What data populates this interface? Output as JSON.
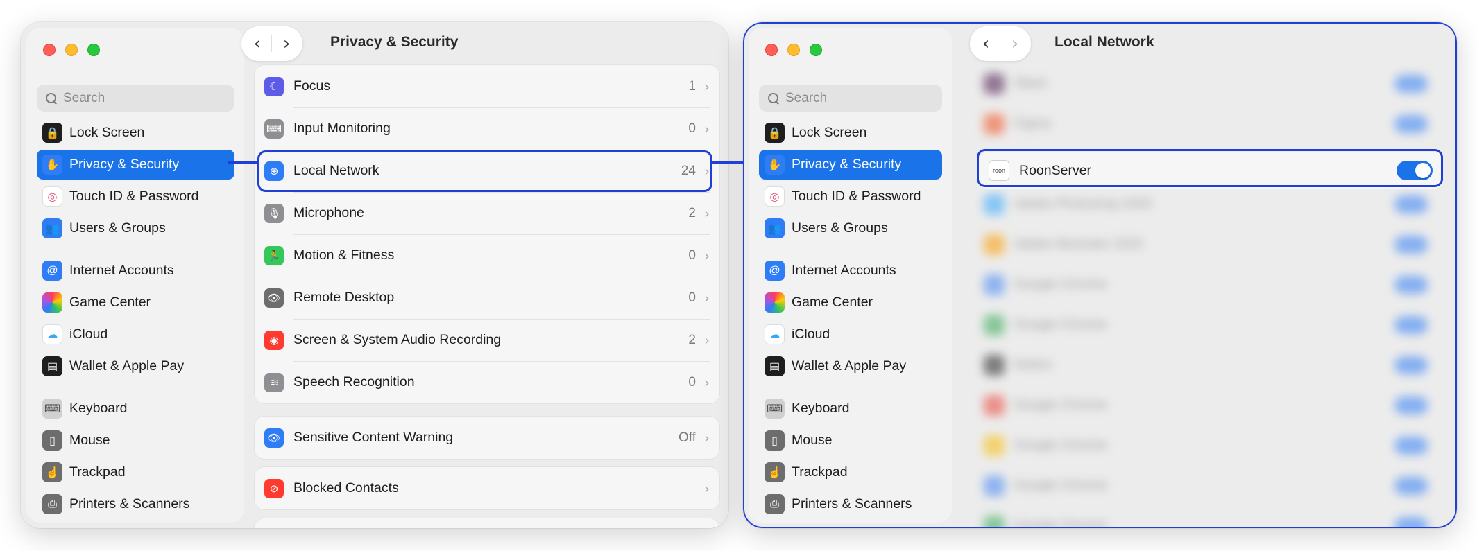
{
  "left_window": {
    "title": "Privacy & Security",
    "search_placeholder": "Search",
    "sidebar": [
      {
        "label": "Lock Screen",
        "icon": "lock-icon",
        "glyph": "🔒"
      },
      {
        "label": "Privacy & Security",
        "icon": "hand-icon",
        "glyph": "✋",
        "selected": true
      },
      {
        "label": "Touch ID & Password",
        "icon": "fingerprint-icon",
        "glyph": "◎"
      },
      {
        "label": "Users & Groups",
        "icon": "users-icon",
        "glyph": "👥"
      },
      {
        "label": "Internet Accounts",
        "icon": "at-icon",
        "glyph": "@"
      },
      {
        "label": "Game Center",
        "icon": "game-center-icon",
        "glyph": ""
      },
      {
        "label": "iCloud",
        "icon": "cloud-icon",
        "glyph": "☁"
      },
      {
        "label": "Wallet & Apple Pay",
        "icon": "wallet-icon",
        "glyph": "▤"
      },
      {
        "label": "Keyboard",
        "icon": "keyboard-icon",
        "glyph": "⌨"
      },
      {
        "label": "Mouse",
        "icon": "mouse-icon",
        "glyph": "▯"
      },
      {
        "label": "Trackpad",
        "icon": "trackpad-icon",
        "glyph": "☝"
      },
      {
        "label": "Printers & Scanners",
        "icon": "printer-icon",
        "glyph": "⎙"
      }
    ],
    "privacy_rows": [
      {
        "label": "Focus",
        "count": "1",
        "icon": "moon-icon",
        "glyph": "☾"
      },
      {
        "label": "Input Monitoring",
        "count": "0",
        "icon": "keyboard-icon",
        "glyph": "⌨"
      },
      {
        "label": "Local Network",
        "count": "24",
        "icon": "globe-icon",
        "glyph": "⊕"
      },
      {
        "label": "Microphone",
        "count": "2",
        "icon": "microphone-icon",
        "glyph": "🎙"
      },
      {
        "label": "Motion & Fitness",
        "count": "0",
        "icon": "running-icon",
        "glyph": "🏃"
      },
      {
        "label": "Remote Desktop",
        "count": "0",
        "icon": "binoculars-icon",
        "glyph": "👁"
      },
      {
        "label": "Screen & System Audio Recording",
        "count": "2",
        "icon": "record-icon",
        "glyph": "◉"
      },
      {
        "label": "Speech Recognition",
        "count": "0",
        "icon": "waveform-icon",
        "glyph": "≋"
      }
    ],
    "sensitive_row": {
      "label": "Sensitive Content Warning",
      "value": "Off",
      "icon": "eye-icon",
      "glyph": "👁"
    },
    "blocked_row": {
      "label": "Blocked Contacts",
      "icon": "blocked-icon",
      "glyph": "⊘"
    }
  },
  "right_window": {
    "title": "Local Network",
    "search_placeholder": "Search",
    "highlighted_app": {
      "label": "RoonServer",
      "logo_text": "roon",
      "enabled": true
    },
    "blurred_apps": [
      "Slack",
      "Figma",
      "RoonServer",
      "Adobe Photoshop 2025",
      "Adobe Illustrator 2025",
      "Google Chrome",
      "Google Chrome",
      "Notion",
      "Google Chrome",
      "Google Chrome",
      "Google Chrome",
      "Google Chrome"
    ]
  },
  "colors": {
    "accent": "#1a73e8",
    "highlight": "#1f3fd6"
  }
}
